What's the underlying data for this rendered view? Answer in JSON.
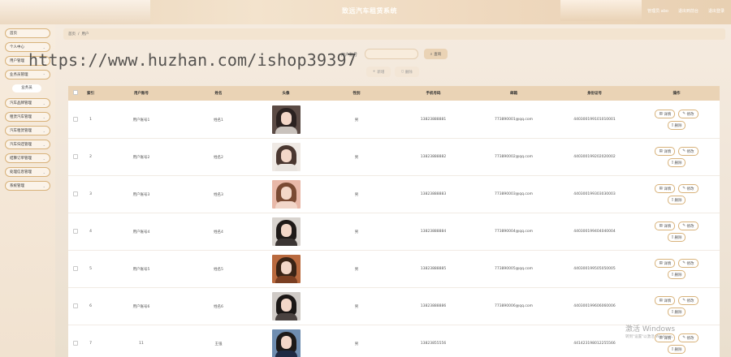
{
  "app": {
    "title": "致远汽车租赁系统",
    "top_links": [
      "管理员 abo",
      "退出到前台",
      "退出登录"
    ]
  },
  "sidebar": {
    "items": [
      {
        "label": "首页"
      },
      {
        "label": "个人中心"
      },
      {
        "label": "用户管理"
      },
      {
        "label": "业务员管理"
      },
      {
        "label": "汽车品牌管理"
      },
      {
        "label": "租赁汽车管理"
      },
      {
        "label": "汽车租赁管理"
      },
      {
        "label": "汽车归还管理"
      },
      {
        "label": "结算订单管理"
      },
      {
        "label": "处理信息管理"
      },
      {
        "label": "系统管理"
      }
    ],
    "active_submenu": "业务员"
  },
  "breadcrumb": [
    "首页",
    "用户"
  ],
  "search": {
    "label": "用户账号",
    "value": "",
    "button": "查询",
    "add_button": "新增",
    "delete_button": "删除"
  },
  "watermark": "https://www.huzhan.com/ishop39397",
  "table": {
    "headers": [
      "索引",
      "用户账号",
      "姓名",
      "头像",
      "性别",
      "手机号码",
      "邮箱",
      "身份证号",
      "操作"
    ],
    "rows": [
      {
        "idx": "1",
        "account": "用户账号1",
        "name": "姓名1",
        "sex": "男",
        "phone": "13823888881",
        "email": "773890001@qq.com",
        "idcard": "440300199101010001"
      },
      {
        "idx": "2",
        "account": "用户账号2",
        "name": "姓名2",
        "sex": "男",
        "phone": "13823888882",
        "email": "773890002@qq.com",
        "idcard": "440300199202020002"
      },
      {
        "idx": "3",
        "account": "用户账号3",
        "name": "姓名3",
        "sex": "男",
        "phone": "13823888883",
        "email": "773890003@qq.com",
        "idcard": "440300199303030003"
      },
      {
        "idx": "4",
        "account": "用户账号4",
        "name": "姓名4",
        "sex": "男",
        "phone": "13823888884",
        "email": "773890004@qq.com",
        "idcard": "440300199404040004"
      },
      {
        "idx": "5",
        "account": "用户账号5",
        "name": "姓名5",
        "sex": "男",
        "phone": "13823888885",
        "email": "773890005@qq.com",
        "idcard": "440300199505050005"
      },
      {
        "idx": "6",
        "account": "用户账号6",
        "name": "姓名6",
        "sex": "男",
        "phone": "13823888886",
        "email": "773890006@qq.com",
        "idcard": "440300199606060006"
      },
      {
        "idx": "7",
        "account": "11",
        "name": "王强",
        "sex": "男",
        "phone": "13823855556",
        "email": "",
        "idcard": "441423198012255566"
      }
    ],
    "ops": {
      "detail": "详情",
      "edit": "修改",
      "delete": "删除"
    }
  },
  "activation": {
    "title": "激活 Windows",
    "subtitle": "转到\"设置\"以激活 Windows。"
  },
  "colors": {
    "accent": "#d8b27a",
    "header_row": "#ead3b5",
    "button": "#ead3b5"
  }
}
